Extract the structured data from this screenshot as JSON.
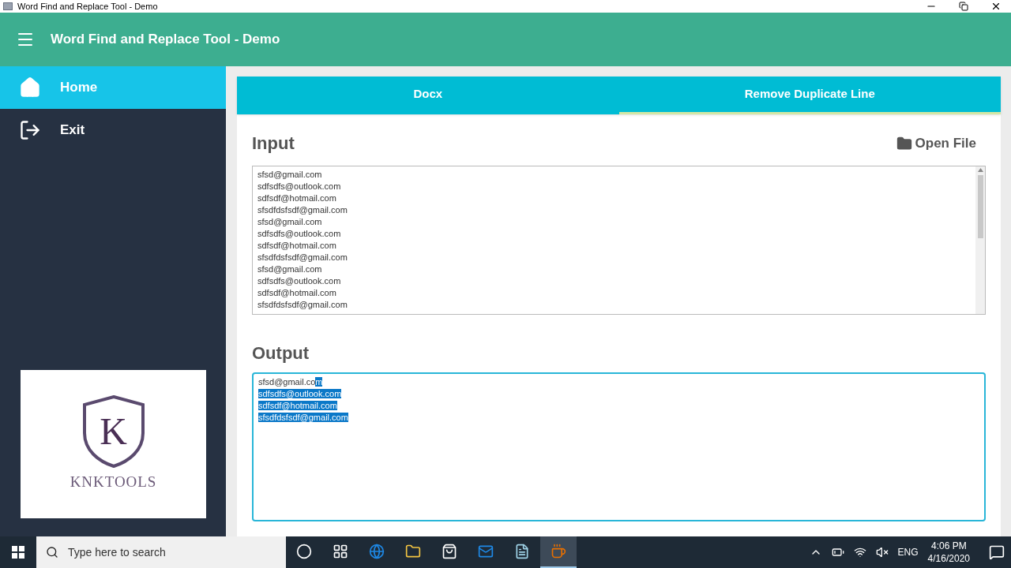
{
  "window": {
    "title": "Word Find and Replace Tool - Demo"
  },
  "header": {
    "title": "Word Find and Replace Tool - Demo"
  },
  "sidebar": {
    "items": [
      {
        "label": "Home",
        "kind": "home",
        "selected": true
      },
      {
        "label": "Exit",
        "kind": "exit",
        "selected": false
      }
    ],
    "logo": {
      "letter": "K",
      "name": "KNKTOOLS"
    }
  },
  "tabs": [
    {
      "label": "Docx",
      "selected": false
    },
    {
      "label": "Remove Duplicate Line",
      "selected": true
    }
  ],
  "input": {
    "heading": "Input",
    "open_button": "Open File",
    "lines": [
      "sfsd@gmail.com",
      "sdfsdfs@outlook.com",
      "sdfsdf@hotmail.com",
      "sfsdfdsfsdf@gmail.com",
      "sfsd@gmail.com",
      "sdfsdfs@outlook.com",
      "sdfsdf@hotmail.com",
      "sfsdfdsfsdf@gmail.com",
      "sfsd@gmail.com",
      "sdfsdfs@outlook.com",
      "sdfsdf@hotmail.com",
      "sfsdfdsfsdf@gmail.com"
    ]
  },
  "output": {
    "heading": "Output",
    "lines": [
      [
        {
          "text": "sfsd@gmail.co",
          "selected": false
        },
        {
          "text": "m",
          "selected": true
        }
      ],
      [
        {
          "text": "sdfsdfs@outlook.com",
          "selected": true
        }
      ],
      [
        {
          "text": "sdfsdf@hotmail.com",
          "selected": true
        }
      ],
      [
        {
          "text": "sfsdfdsfsdf@gmail.com",
          "selected": true
        }
      ]
    ]
  },
  "taskbar": {
    "search_placeholder": "Type here to search",
    "apps": [
      {
        "kind": "cortana",
        "selected": false
      },
      {
        "kind": "taskview",
        "selected": false
      },
      {
        "kind": "edge",
        "selected": false
      },
      {
        "kind": "folder",
        "selected": false
      },
      {
        "kind": "store",
        "selected": false
      },
      {
        "kind": "mail",
        "selected": false
      },
      {
        "kind": "notepad",
        "selected": false
      },
      {
        "kind": "java",
        "selected": true
      }
    ],
    "language": "ENG",
    "time": "4:06 PM",
    "date": "4/16/2020"
  }
}
